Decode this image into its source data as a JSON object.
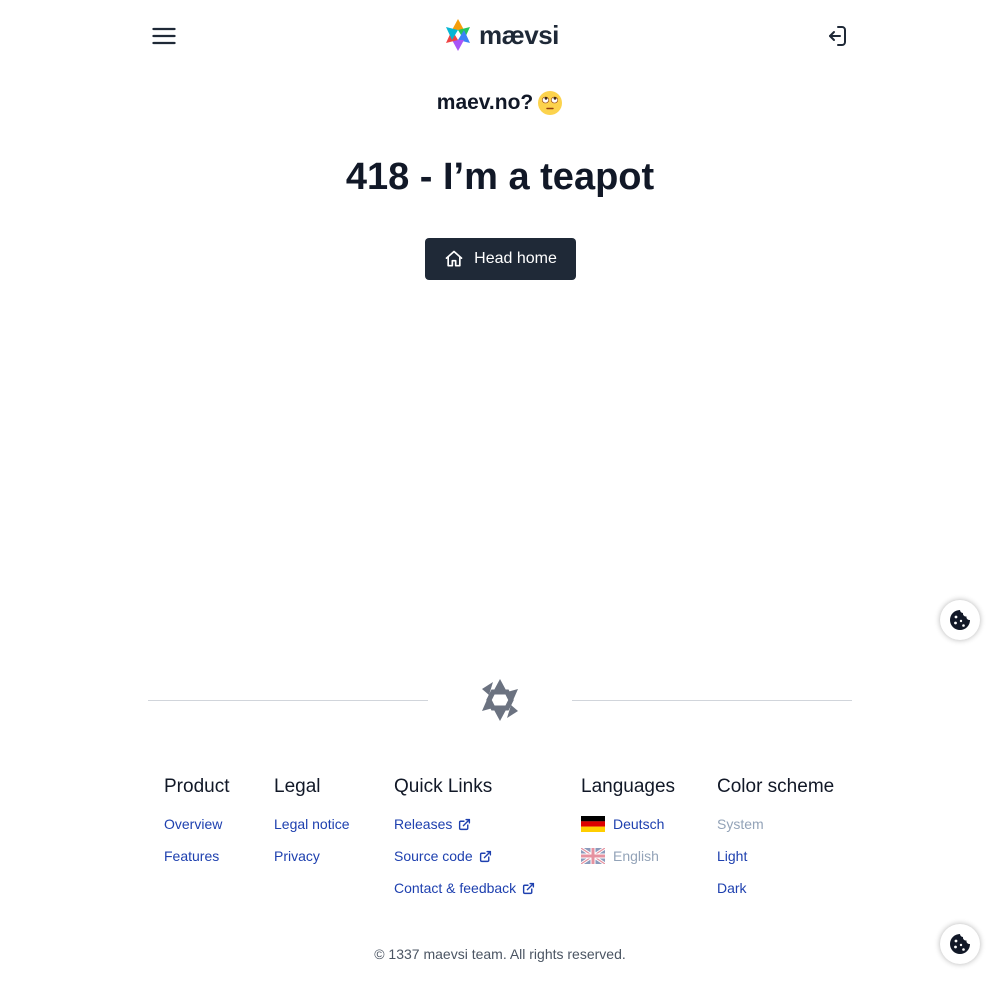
{
  "header": {
    "logo_text": "mævsi",
    "menu_icon": "hamburger-menu-icon",
    "signin_icon": "sign-in-icon"
  },
  "tagline": {
    "text": "maev.no?",
    "emoji": "face-with-rolling-eyes-emoji"
  },
  "error": {
    "title": "418 - I’m a teapot"
  },
  "home_button": {
    "label": "Head home",
    "icon": "home-icon"
  },
  "footer": {
    "columns": {
      "product": {
        "title": "Product",
        "links": [
          "Overview",
          "Features"
        ]
      },
      "legal": {
        "title": "Legal",
        "links": [
          "Legal notice",
          "Privacy"
        ]
      },
      "quick_links": {
        "title": "Quick Links",
        "links": [
          "Releases",
          "Source code",
          "Contact & feedback"
        ]
      },
      "languages": {
        "title": "Languages",
        "links": [
          "Deutsch",
          "English"
        ],
        "selected": "English"
      },
      "color_scheme": {
        "title": "Color scheme",
        "links": [
          "System",
          "Light",
          "Dark"
        ],
        "selected": "System"
      }
    },
    "copyright": "© 1337 maevsi team. All rights reserved."
  },
  "colors": {
    "primary_dark": "#1f2937",
    "link": "#1e40af",
    "muted": "#93a3b8",
    "divider": "#d1d5db"
  }
}
